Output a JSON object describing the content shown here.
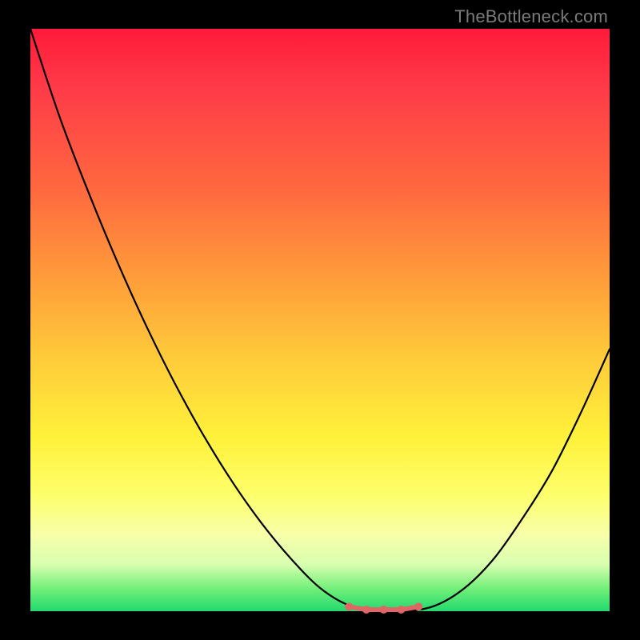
{
  "watermark": {
    "text": "TheBottleneck.com"
  },
  "colors": {
    "curve_stroke": "#000000",
    "marker_stroke": "#e06666",
    "marker_fill": "#e06666",
    "bg_top": "#ff1a3a",
    "bg_mid": "#fff13a",
    "bg_bottom": "#22d96e",
    "frame": "#000000"
  },
  "chart_data": {
    "type": "line",
    "title": "",
    "xlabel": "",
    "ylabel": "",
    "x": [
      0.0,
      0.05,
      0.1,
      0.15,
      0.2,
      0.25,
      0.3,
      0.35,
      0.4,
      0.45,
      0.5,
      0.55,
      0.6,
      0.65,
      0.7,
      0.75,
      0.8,
      0.85,
      0.9,
      0.95,
      1.0
    ],
    "series": [
      {
        "name": "bottleneck-curve",
        "values": [
          1.0,
          0.85,
          0.72,
          0.6,
          0.49,
          0.39,
          0.3,
          0.22,
          0.15,
          0.09,
          0.04,
          0.01,
          0.0,
          0.0,
          0.01,
          0.04,
          0.09,
          0.16,
          0.24,
          0.34,
          0.45
        ]
      }
    ],
    "markers": {
      "name": "optimal-range",
      "x": [
        0.55,
        0.58,
        0.61,
        0.64,
        0.67
      ],
      "y": [
        0.005,
        0.0,
        0.0,
        0.0,
        0.005
      ]
    },
    "xlim": [
      0,
      1
    ],
    "ylim": [
      0,
      1
    ],
    "grid": false,
    "legend": false
  }
}
